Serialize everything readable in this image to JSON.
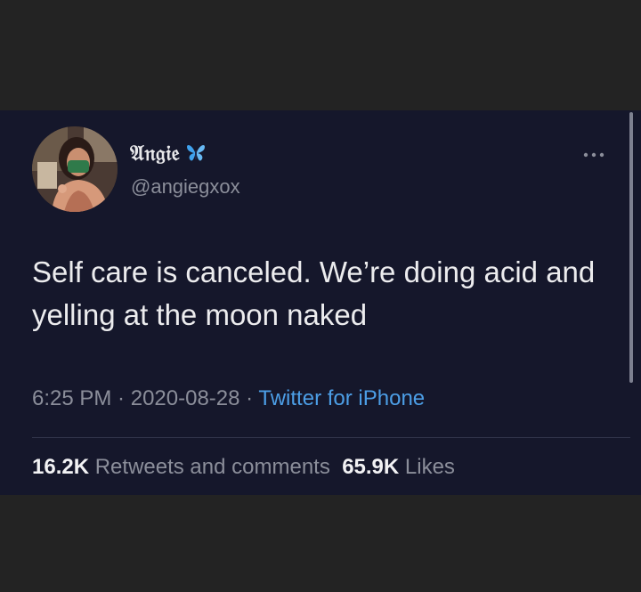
{
  "tweet": {
    "author": {
      "display_name": "𝔄𝔫𝔤𝔦𝔢",
      "handle": "@angiegxox",
      "name_emoji": "butterfly-icon"
    },
    "text": "Self care is canceled. We’re doing acid and yelling at the moon naked",
    "time": "6:25 PM",
    "date": "2020-08-28",
    "separator": " · ",
    "source": "Twitter for iPhone",
    "stats": {
      "retweets_count": "16.2K",
      "retweets_label": "Retweets and comments",
      "likes_count": "65.9K",
      "likes_label": "Likes"
    }
  },
  "colors": {
    "card_background": "#15172b",
    "page_background": "#232323",
    "link": "#4c9ee6",
    "muted_text": "#8b8e9a"
  },
  "icons": {
    "more": "more-options-icon",
    "verified_like": "butterfly-icon"
  }
}
